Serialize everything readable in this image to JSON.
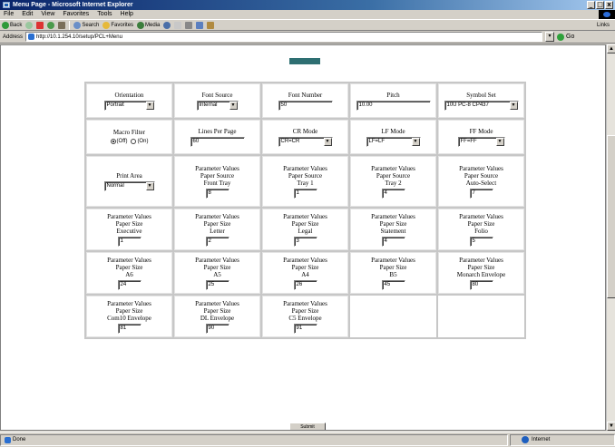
{
  "window": {
    "title": "Menu Page - Microsoft Internet Explorer",
    "min": "_",
    "max": "□",
    "close": "x"
  },
  "menu": [
    "File",
    "Edit",
    "View",
    "Favorites",
    "Tools",
    "Help"
  ],
  "toolbar": {
    "back": "Back",
    "search": "Search",
    "favorites": "Favorites",
    "media": "Media",
    "links": "Links"
  },
  "address": {
    "label": "Address",
    "url": "http://10.1.254.10/setup/PCL+Menu",
    "go": "Go"
  },
  "form": {
    "orientation": {
      "label": "Orientation",
      "value": "Portrait"
    },
    "font_source": {
      "label": "Font Source",
      "value": "Internal"
    },
    "font_number": {
      "label": "Font Number",
      "value": "50"
    },
    "pitch": {
      "label": "Pitch",
      "value": "10.00"
    },
    "symbol_set": {
      "label": "Symbol Set",
      "value": "10U PC-8 CP437"
    },
    "macro_filter": {
      "label": "Macro Filter",
      "off": "(Off)",
      "on": "(On)"
    },
    "lines_per_page": {
      "label": "Lines Per Page",
      "value": "60"
    },
    "cr_mode": {
      "label": "CR Mode",
      "value": "CR=CR"
    },
    "lf_mode": {
      "label": "LF Mode",
      "value": "LF=LF"
    },
    "ff_mode": {
      "label": "FF Mode",
      "value": "FF=FF"
    },
    "print_area": {
      "label": "Print Area",
      "value": "Normal"
    },
    "param_values": "Parameter Values",
    "paper_source": "Paper Source",
    "paper_size": "Paper Size",
    "src_front_tray": {
      "label": "Front Tray",
      "value": "8"
    },
    "src_tray1": {
      "label": "Tray 1",
      "value": "1"
    },
    "src_tray2": {
      "label": "Tray 2",
      "value": "4"
    },
    "src_auto": {
      "label": "Auto-Select",
      "value": "7"
    },
    "size_executive": {
      "label": "Executive",
      "value": "1"
    },
    "size_letter": {
      "label": "Letter",
      "value": "2"
    },
    "size_legal": {
      "label": "Legal",
      "value": "3"
    },
    "size_statement": {
      "label": "Statement",
      "value": "4"
    },
    "size_folio": {
      "label": "Folio",
      "value": "5"
    },
    "size_a6": {
      "label": "A6",
      "value": "24"
    },
    "size_a5": {
      "label": "A5",
      "value": "25"
    },
    "size_a4": {
      "label": "A4",
      "value": "26"
    },
    "size_b5": {
      "label": "B5",
      "value": "45"
    },
    "size_monarch": {
      "label": "Monarch Envelope",
      "value": "80"
    },
    "size_com10": {
      "label": "Com10 Envelope",
      "value": "81"
    },
    "size_dl": {
      "label": "DL Envelope",
      "value": "90"
    },
    "size_c5": {
      "label": "C5 Envelope",
      "value": "91"
    }
  },
  "submit_label": "Submit",
  "status": {
    "left": "Done",
    "zone": "Internet"
  },
  "colors": {
    "title_gradient_start": "#0a246a",
    "chrome": "#d4d0c8",
    "cell_border": "#c7c7c7"
  }
}
